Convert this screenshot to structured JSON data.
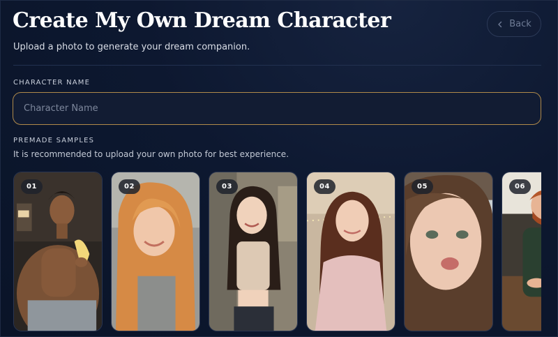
{
  "header": {
    "title": "Create My Own Dream Character",
    "subtitle": "Upload a photo to generate your dream companion.",
    "back_label": "Back"
  },
  "form": {
    "name_section_label": "CHARACTER NAME",
    "name_placeholder": "Character Name",
    "samples_section_label": "PREMADE SAMPLES",
    "samples_hint": "It is recommended to upload your own photo for best experience."
  },
  "samples": [
    {
      "number": "01"
    },
    {
      "number": "02"
    },
    {
      "number": "03"
    },
    {
      "number": "04"
    },
    {
      "number": "05"
    },
    {
      "number": "06"
    }
  ],
  "colors": {
    "background": "#0d1830",
    "input_border": "#b08a4a",
    "back_text": "#6f7c96"
  },
  "icons": {
    "back": "chevron-left-icon"
  }
}
